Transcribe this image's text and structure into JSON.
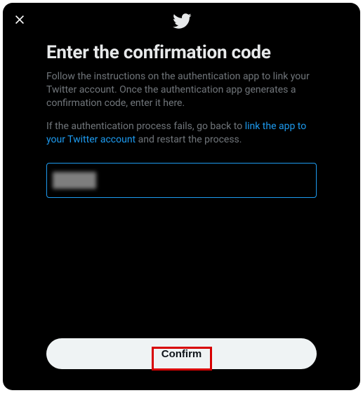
{
  "modal": {
    "title": "Enter the confirmation code",
    "body1": "Follow the instructions on the authentication app to link your Twitter account. Once the authentication app generates a confirmation code, enter it here.",
    "body2_prefix": "If the authentication process fails, go back to ",
    "body2_link": "link the app to your Twitter account",
    "body2_suffix": " and restart the process.",
    "confirm_label": "Confirm"
  }
}
